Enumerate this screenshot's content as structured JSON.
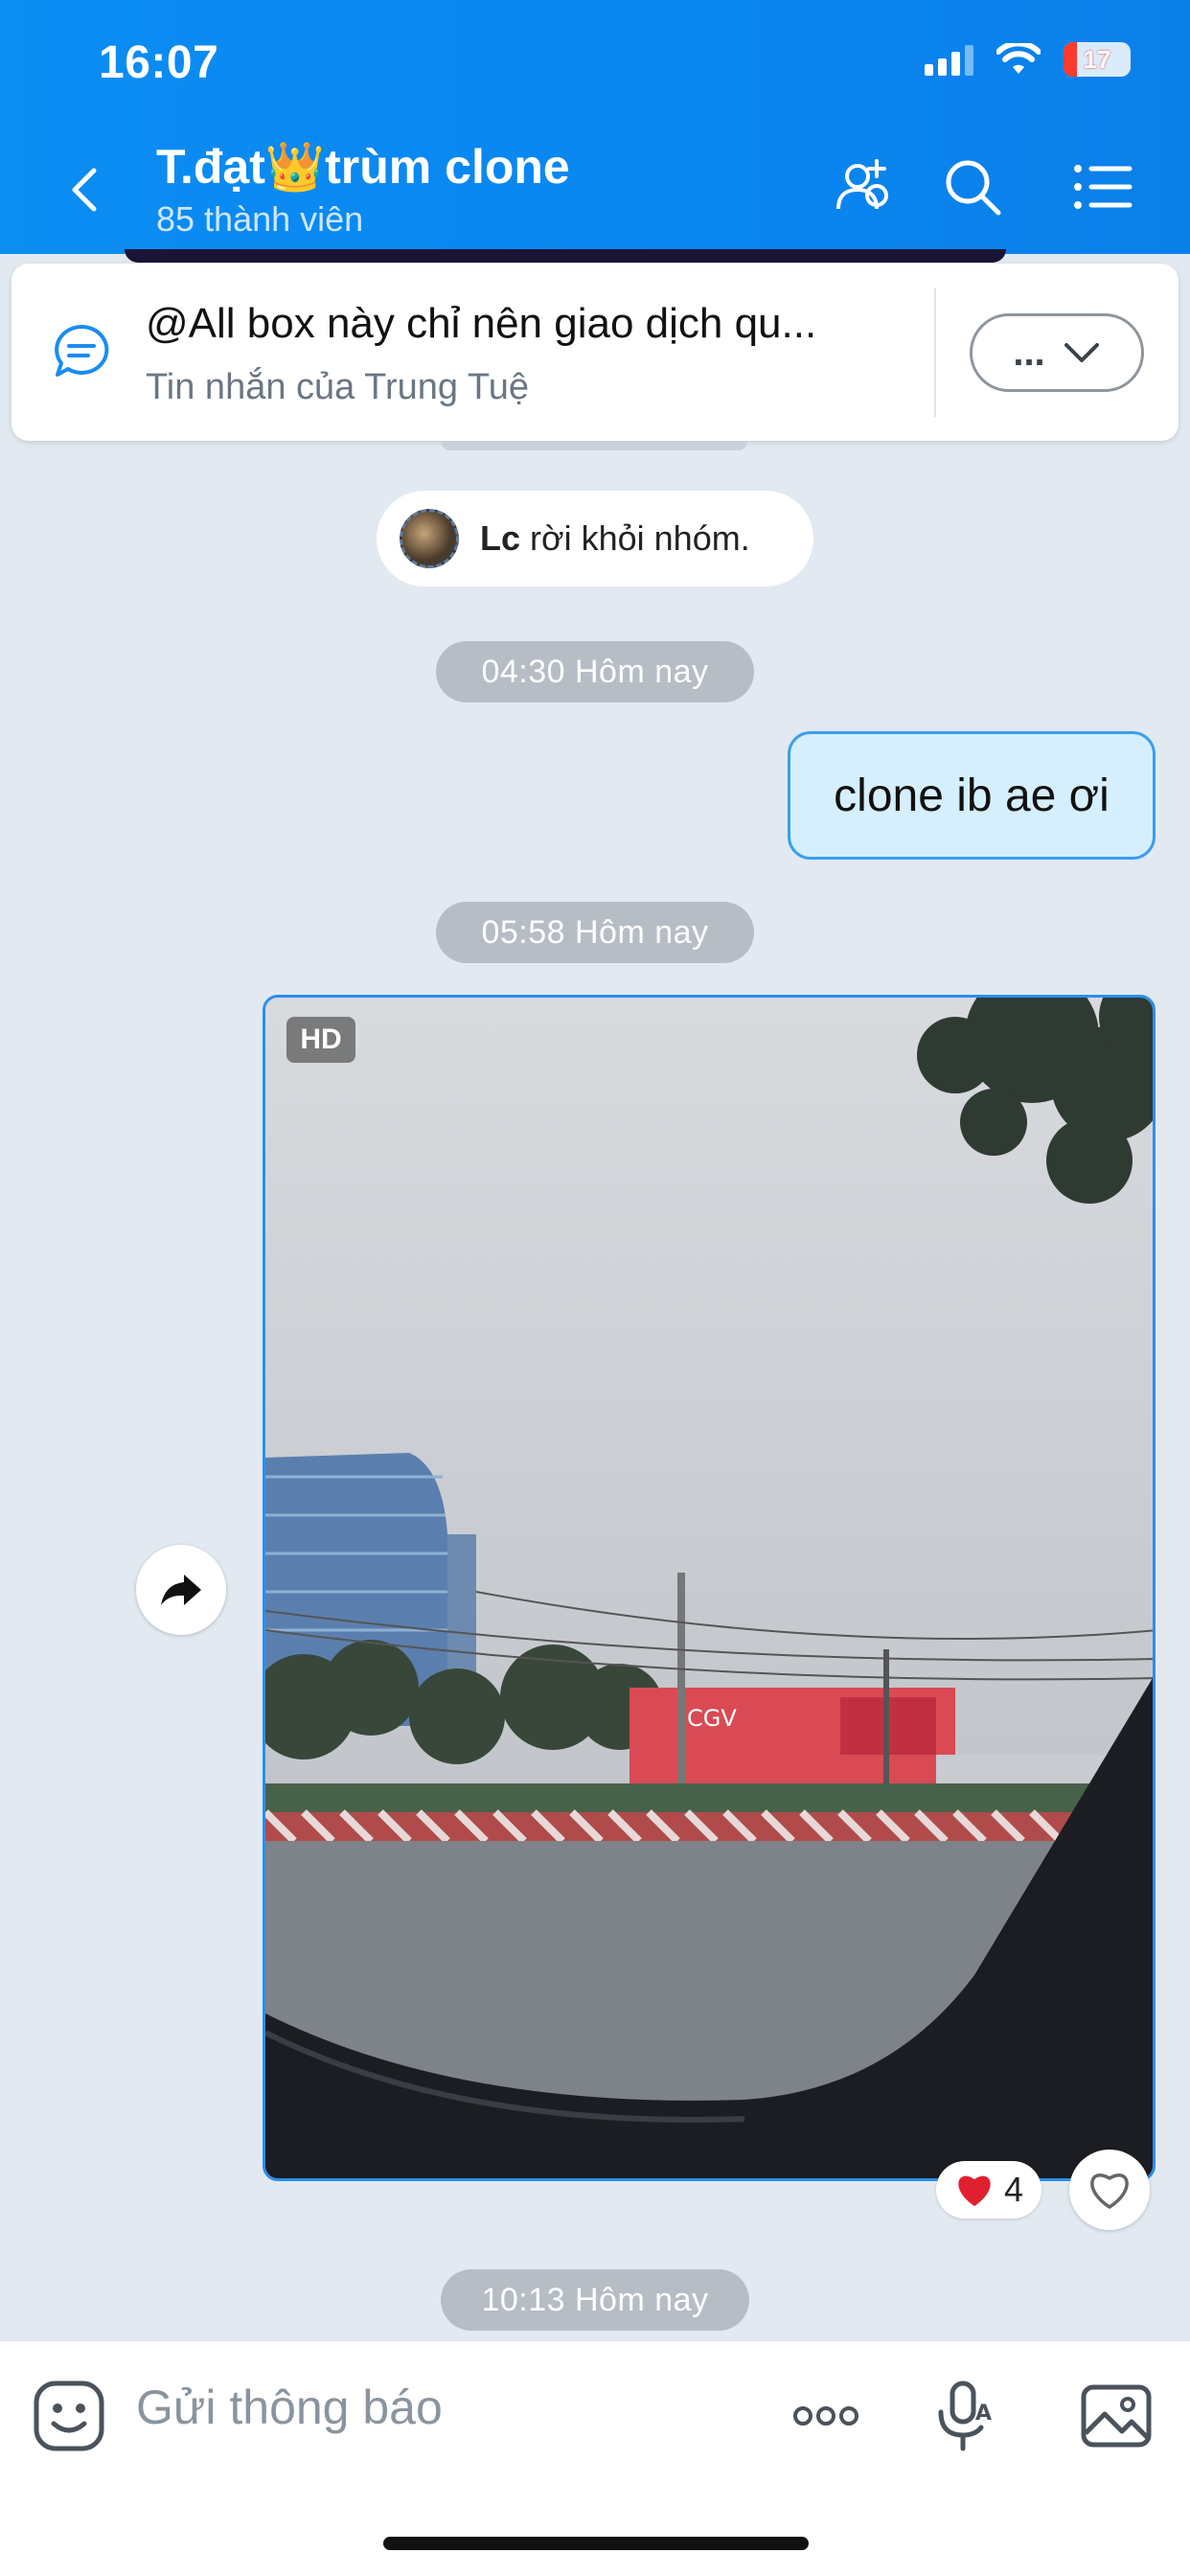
{
  "status_bar": {
    "time": "16:07",
    "battery": "17"
  },
  "header": {
    "title": "T.đạt👑trùm clone",
    "subtitle": "85 thành viên"
  },
  "pinned": {
    "text": "@All  box này chỉ nên giao dịch qu...",
    "sender": "Tin nhắn của Trung Tuệ",
    "more_label": "..."
  },
  "messages": {
    "system_name": "Lc",
    "system_text": " rời khỏi nhóm.",
    "time1": "04:30 Hôm nay",
    "outgoing_text": "clone ib ae ơi",
    "time2": "05:58 Hôm nay",
    "photo_badge": "HD",
    "reaction_count": "4",
    "time3": "10:13 Hôm nay"
  },
  "composer": {
    "placeholder": "Gửi thông báo"
  },
  "colors": {
    "header": "#0a86f0",
    "bubble_out": "#d5efff",
    "accent": "#2a8ef0"
  }
}
